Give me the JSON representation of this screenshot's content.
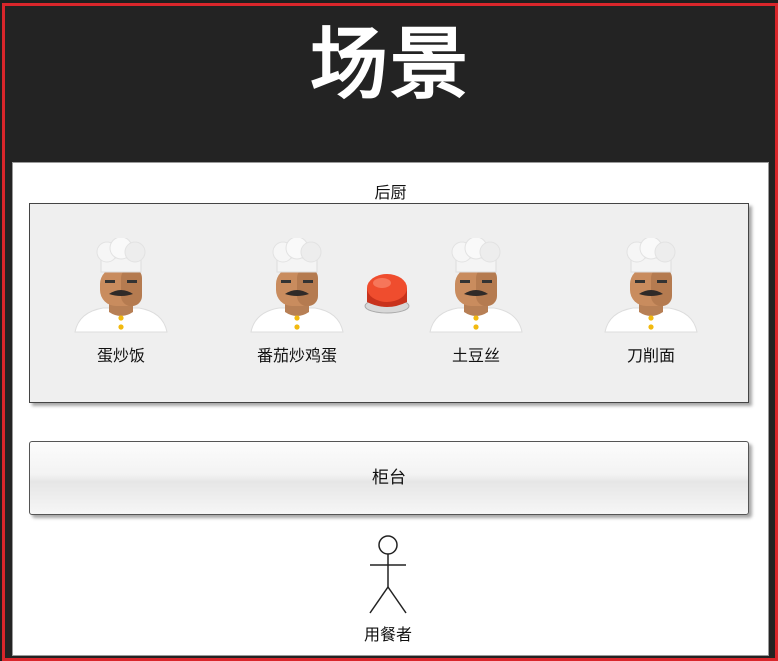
{
  "title": "场景",
  "kitchen": {
    "label": "后厨",
    "chefs": [
      {
        "label": "蛋炒饭"
      },
      {
        "label": "番茄炒鸡蛋"
      },
      {
        "label": "土豆丝"
      },
      {
        "label": "刀削面"
      }
    ],
    "button_icon": "red-push-button-icon"
  },
  "counter": {
    "label": "柜台"
  },
  "diner": {
    "label": "用餐者",
    "icon": "stick-figure-icon"
  },
  "colors": {
    "frame_border": "#d9262b",
    "header_bg": "#232323",
    "button_red": "#e8442a"
  }
}
